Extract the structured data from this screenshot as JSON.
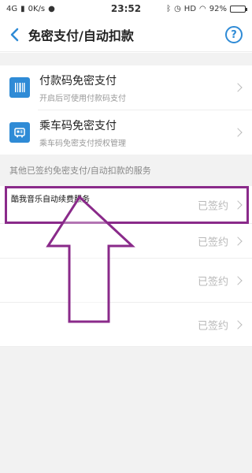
{
  "status_bar": {
    "network": "4G",
    "speed": "0K/s",
    "time": "23:52",
    "hd": "HD",
    "battery": "92%",
    "battery_level": 0.92
  },
  "nav": {
    "title": "免密支付/自动扣款",
    "help": "?"
  },
  "payments": [
    {
      "title": "付款码免密支付",
      "subtitle": "开启后可使用付款码支付",
      "icon": "barcode-icon"
    },
    {
      "title": "乘车码免密支付",
      "subtitle": "乘车码免密支付授权管理",
      "icon": "bus-card-icon"
    }
  ],
  "section_label": "其他已签约免密支付/自动扣款的服务",
  "services": [
    {
      "name": "酷我音乐自动续费服务",
      "status": "已签约"
    },
    {
      "name": "",
      "status": "已签约"
    },
    {
      "name": "",
      "status": "已签约"
    },
    {
      "name": "",
      "status": "已签约"
    }
  ],
  "colors": {
    "accent": "#2f8bd6",
    "annotation": "#8a2a8a",
    "background_band": "#f2f2f2"
  }
}
